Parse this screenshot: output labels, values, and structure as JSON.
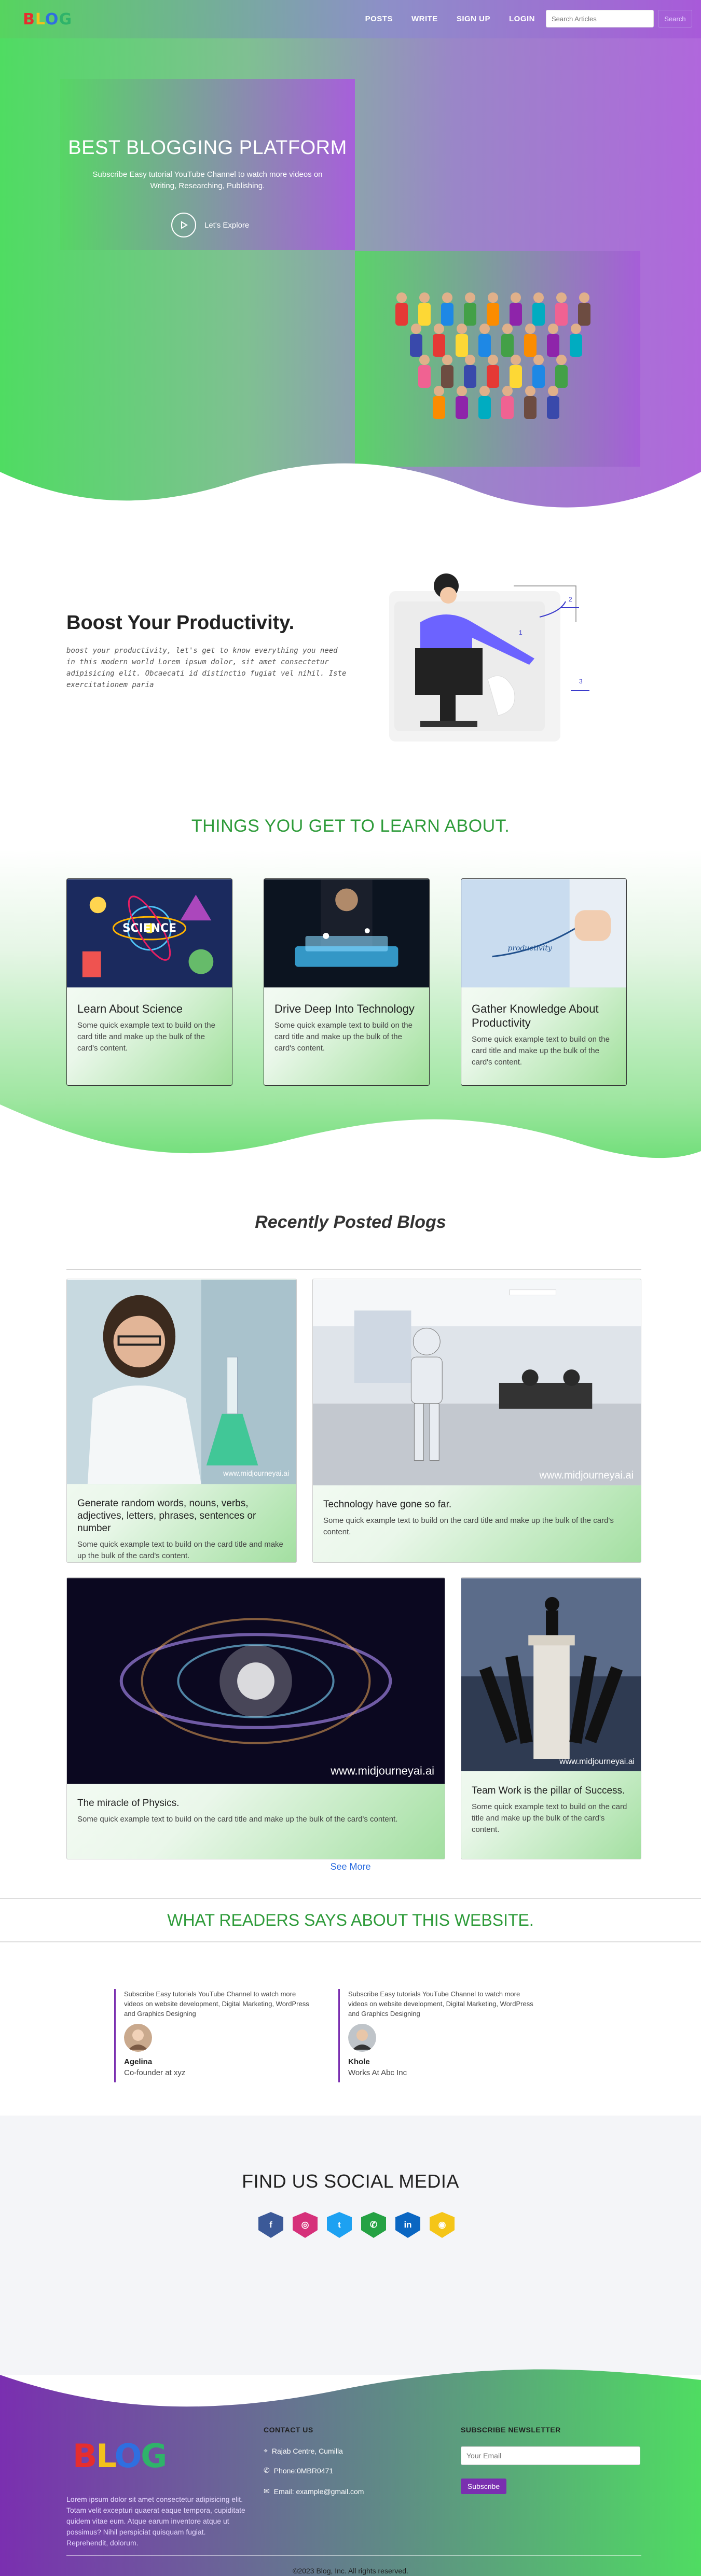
{
  "nav": {
    "logo": [
      "B",
      "L",
      "O",
      "G"
    ],
    "links": [
      "POSTS",
      "WRITE",
      "SIGN UP",
      "LOGIN"
    ],
    "search_placeholder": "Search Articles",
    "search_button": "Search"
  },
  "hero": {
    "title": "BEST BLOGGING PLATFORM",
    "subtitle": "Subscribe Easy tutorial YouTube Channel to watch more videos on Writing, Researching, Publishing.",
    "cta": "Let's Explore"
  },
  "productivity": {
    "title": "Boost Your Productivity.",
    "text": "boost your productivity, let's get to know everything you need in this modern world Lorem ipsum dolor, sit amet consectetur adipisicing elit. Obcaecati id distinctio fugiat vel nihil. Iste exercitationem paria"
  },
  "learn": {
    "title": "THINGS YOU GET TO LEARN ABOUT.",
    "cards": [
      {
        "title": "Learn About Science",
        "text": "Some quick example text to build on the card title and make up the bulk of the card's content.",
        "img_label": "SCIENCE"
      },
      {
        "title": "Drive Deep Into Technology",
        "text": "Some quick example text to build on the card title and make up the bulk of the card's content."
      },
      {
        "title": "Gather Knowledge About Productivity",
        "text": "Some quick example text to build on the card title and make up the bulk of the card's content.",
        "img_label": "productivity"
      }
    ]
  },
  "recent": {
    "title": "Recently Posted Blogs",
    "watermark": "www.midjourneyai.ai",
    "cards": [
      {
        "title": "Generate random words, nouns, verbs, adjectives, letters, phrases, sentences or number",
        "text": "Some quick example text to build on the card title and make up the bulk of the card's content."
      },
      {
        "title": "Technology have gone so far.",
        "text": "Some quick example text to build on the card title and make up the bulk of the card's content."
      },
      {
        "title": "The miracle of Physics.",
        "text": "Some quick example text to build on the card title and make up the bulk of the card's content."
      },
      {
        "title": "Team Work is the pillar of Success.",
        "text": "Some quick example text to build on the card title and make up the bulk of the card's content."
      }
    ],
    "see_more": "See More"
  },
  "testimonials": {
    "title": "WHAT READERS SAYS ABOUT THIS WEBSITE.",
    "items": [
      {
        "quote": "Subscribe Easy tutorials YouTube Channel to watch more videos on website development, Digital Marketing, WordPress and Graphics Designing",
        "name": "Agelina",
        "role": "Co-founder at xyz"
      },
      {
        "quote": "Subscribe Easy tutorials YouTube Channel to watch more videos on website development, Digital Marketing, WordPress and Graphics Designing",
        "name": "Khole",
        "role": "Works At Abc Inc"
      }
    ]
  },
  "social": {
    "title": "FIND US SOCIAL MEDIA",
    "icons": [
      {
        "name": "facebook",
        "glyph": "f",
        "color": "#3b5998"
      },
      {
        "name": "instagram",
        "glyph": "◎",
        "color": "#d6307a"
      },
      {
        "name": "twitter",
        "glyph": "t",
        "color": "#1da1f2"
      },
      {
        "name": "whatsapp",
        "glyph": "✆",
        "color": "#25a244"
      },
      {
        "name": "linkedin",
        "glyph": "in",
        "color": "#0a66c2"
      },
      {
        "name": "snapchat",
        "glyph": "◉",
        "color": "#f5c518"
      }
    ]
  },
  "footer": {
    "logo": [
      "B",
      "L",
      "O",
      "G"
    ],
    "description": "Lorem ipsum dolor sit amet consectetur adipisicing elit. Totam velit excepturi quaerat eaque tempora, cupiditate quidem vitae eum. Atque earum inventore atque ut possimus? Nihil perspiciat quisquam fugiat. Reprehendit, dolorum.",
    "contact_head": "CONTACT US",
    "address": "Rajab Centre, Cumilla",
    "phone": "Phone:0MBR0471",
    "email": "Email: example@gmail.com",
    "newsletter_head": "SUBSCRIBE NEWSLETTER",
    "email_placeholder": "Your Email",
    "subscribe": "Subscribe",
    "copyright": "©2023 Blog, Inc. All rights reserved."
  },
  "colors": {
    "green": "#4fdc62",
    "purple": "#a85ad9",
    "accent": "#7a2fb0",
    "title_green": "#2e9b3a"
  }
}
